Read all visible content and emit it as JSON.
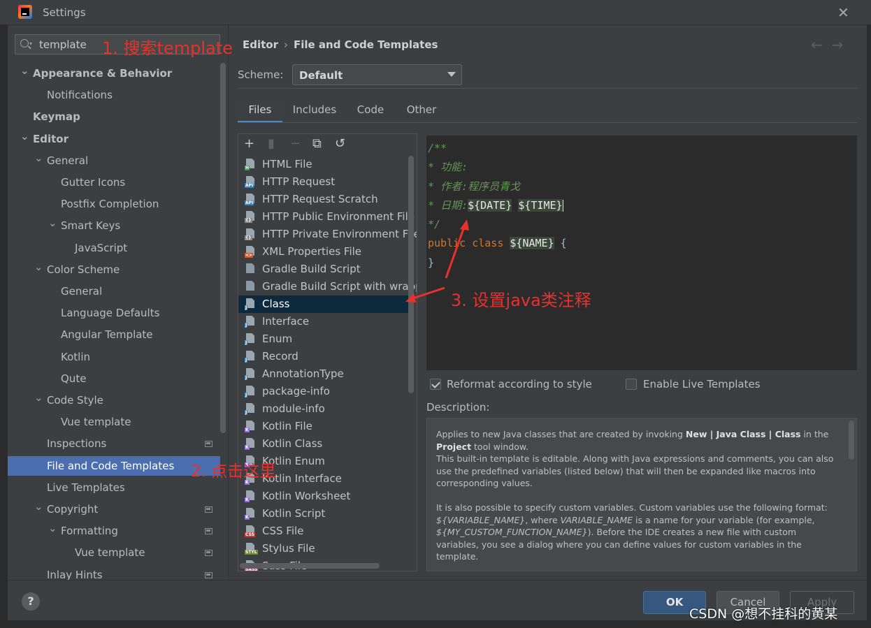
{
  "window": {
    "title": "Settings"
  },
  "search": {
    "value": "template"
  },
  "tree": [
    {
      "label": "Appearance & Behavior",
      "bold": true,
      "level": 0,
      "chevron": "down"
    },
    {
      "label": "Notifications",
      "bold": false,
      "level": 1
    },
    {
      "label": "Keymap",
      "bold": true,
      "level": 0
    },
    {
      "label": "Editor",
      "bold": true,
      "level": 0,
      "chevron": "down"
    },
    {
      "label": "General",
      "bold": false,
      "level": 1,
      "chevron": "down"
    },
    {
      "label": "Gutter Icons",
      "bold": false,
      "level": 2
    },
    {
      "label": "Postfix Completion",
      "bold": false,
      "level": 2
    },
    {
      "label": "Smart Keys",
      "bold": false,
      "level": 2,
      "chevron": "down"
    },
    {
      "label": "JavaScript",
      "bold": false,
      "level": 3
    },
    {
      "label": "Color Scheme",
      "bold": false,
      "level": 1,
      "chevron": "down"
    },
    {
      "label": "General",
      "bold": false,
      "level": 2
    },
    {
      "label": "Language Defaults",
      "bold": false,
      "level": 2
    },
    {
      "label": "Angular Template",
      "bold": false,
      "level": 2
    },
    {
      "label": "Kotlin",
      "bold": false,
      "level": 2
    },
    {
      "label": "Qute",
      "bold": false,
      "level": 2
    },
    {
      "label": "Code Style",
      "bold": false,
      "level": 1,
      "chevron": "down"
    },
    {
      "label": "Vue template",
      "bold": false,
      "level": 2
    },
    {
      "label": "Inspections",
      "bold": false,
      "level": 1,
      "projectIcon": true
    },
    {
      "label": "File and Code Templates",
      "bold": false,
      "level": 1,
      "selected": true
    },
    {
      "label": "Live Templates",
      "bold": false,
      "level": 1
    },
    {
      "label": "Copyright",
      "bold": false,
      "level": 1,
      "chevron": "down",
      "projectIcon": true
    },
    {
      "label": "Formatting",
      "bold": false,
      "level": 2,
      "chevron": "down",
      "projectIcon": true
    },
    {
      "label": "Vue template",
      "bold": false,
      "level": 3,
      "projectIcon": true
    },
    {
      "label": "Inlay Hints",
      "bold": false,
      "level": 1,
      "projectIcon": true
    }
  ],
  "breadcrumb": {
    "parent": "Editor",
    "separator": "›",
    "current": "File and Code Templates"
  },
  "nav": {
    "back": "←",
    "forward": "→"
  },
  "scheme": {
    "label": "Scheme:",
    "value": "Default"
  },
  "tabs": [
    "Files",
    "Includes",
    "Code",
    "Other"
  ],
  "activeTab": "Files",
  "toolbar": {
    "add": "+",
    "copy_disabled": "▮",
    "remove": "−",
    "duplicate": "⧉",
    "reset": "↺"
  },
  "templates": [
    {
      "name": "HTML File",
      "icon": "html-file-icon",
      "tag": "H",
      "color": "#3b9a51"
    },
    {
      "name": "HTTP Request",
      "icon": "http-request-icon",
      "tag": "API",
      "color": "#3a85b8"
    },
    {
      "name": "HTTP Request Scratch",
      "icon": "http-scratch-icon",
      "tag": "API",
      "color": "#3a85b8"
    },
    {
      "name": "HTTP Public Environment File",
      "icon": "env-file-icon",
      "tag": "{}",
      "color": "#8a8a8a"
    },
    {
      "name": "HTTP Private Environment File",
      "icon": "env-file-icon",
      "tag": "{}",
      "color": "#8a8a8a"
    },
    {
      "name": "XML Properties File",
      "icon": "xml-file-icon",
      "tag": "<>",
      "color": "#cf5e32"
    },
    {
      "name": "Gradle Build Script",
      "icon": "gradle-icon",
      "tag": "",
      "color": "#8a9aa4"
    },
    {
      "name": "Gradle Build Script with wrapp",
      "icon": "gradle-icon",
      "tag": "",
      "color": "#8a9aa4"
    },
    {
      "name": "Class",
      "icon": "java-file-icon",
      "tag": "J",
      "color": "#3a85b8",
      "selected": true
    },
    {
      "name": "Interface",
      "icon": "java-file-icon",
      "tag": "J",
      "color": "#3a85b8"
    },
    {
      "name": "Enum",
      "icon": "java-file-icon",
      "tag": "J",
      "color": "#3a85b8"
    },
    {
      "name": "Record",
      "icon": "java-file-icon",
      "tag": "J",
      "color": "#3a85b8"
    },
    {
      "name": "AnnotationType",
      "icon": "java-file-icon",
      "tag": "J",
      "color": "#3a85b8"
    },
    {
      "name": "package-info",
      "icon": "java-file-icon",
      "tag": "J",
      "color": "#3a85b8"
    },
    {
      "name": "module-info",
      "icon": "java-file-icon",
      "tag": "J",
      "color": "#3a85b8"
    },
    {
      "name": "Kotlin File",
      "icon": "kotlin-file-icon",
      "tag": "K",
      "color": "#8e6ed6"
    },
    {
      "name": "Kotlin Class",
      "icon": "kotlin-file-icon",
      "tag": "K",
      "color": "#8e6ed6"
    },
    {
      "name": "Kotlin Enum",
      "icon": "kotlin-file-icon",
      "tag": "K",
      "color": "#8e6ed6"
    },
    {
      "name": "Kotlin Interface",
      "icon": "kotlin-file-icon",
      "tag": "K",
      "color": "#8e6ed6"
    },
    {
      "name": "Kotlin Worksheet",
      "icon": "kotlin-file-icon",
      "tag": "K",
      "color": "#8e6ed6"
    },
    {
      "name": "Kotlin Script",
      "icon": "kotlin-file-icon",
      "tag": "K",
      "color": "#8e6ed6"
    },
    {
      "name": "CSS File",
      "icon": "css-file-icon",
      "tag": "CSS",
      "color": "#c43b3b"
    },
    {
      "name": "Stylus File",
      "icon": "stylus-file-icon",
      "tag": "STYL",
      "color": "#6e8c2d"
    },
    {
      "name": "Sass File",
      "icon": "sass-file-icon",
      "tag": "SASS",
      "color": "#c14c7e"
    }
  ],
  "code": {
    "line1": "/**",
    "line2_prefix": "* ",
    "line2_text": "功能:",
    "line3_prefix": "* ",
    "line3_text": "作者:程序员青戈",
    "line4_prefix": "* ",
    "line4_text": "日期:",
    "var_date": "${DATE}",
    "var_time": "${TIME}",
    "line5": "*/",
    "kw_public": "public",
    "kw_class": "class",
    "var_name": "${NAME}",
    "brace_open": "{",
    "brace_close": "}"
  },
  "options": {
    "reformat": {
      "label": "Reformat according to style",
      "checked": true
    },
    "live": {
      "label": "Enable Live Templates",
      "checked": false
    }
  },
  "description": {
    "label": "Description:",
    "p1_a": "Applies to new Java classes that are created by invoking ",
    "p1_b": "New | Java Class | Class",
    "p1_c": " in the ",
    "p1_d": "Project",
    "p1_e": " tool window.",
    "p1_f": "This built-in template is editable. Along with Java expressions and comments, you can also use the predefined variables (listed below) that will then be expanded like macros into corresponding values.",
    "p2_a": "It is also possible to specify custom variables. Custom variables use the following format: ",
    "p2_b": "${VARIABLE_NAME}",
    "p2_c": ", where ",
    "p2_d": "VARIABLE_NAME",
    "p2_e": " is a name for your variable (for example, ",
    "p2_f": "${MY_CUSTOM_FUNCTION_NAME}",
    "p2_g": "). Before the IDE creates a new file with custom variables, you see a dialog where you can define values for custom variables in the template."
  },
  "buttons": {
    "help": "?",
    "ok": "OK",
    "cancel": "Cancel",
    "apply": "Apply"
  },
  "annotations": {
    "a1": "1. 搜索template",
    "a2": "2. 点击这里",
    "a3": "3. 设置java类注释"
  },
  "watermark": "CSDN @想不挂科的黄某",
  "colors": {
    "selection": "#4b6eaf",
    "accent": "#4a88c7",
    "annotation": "#e8312d",
    "primary_button": "#365880"
  }
}
